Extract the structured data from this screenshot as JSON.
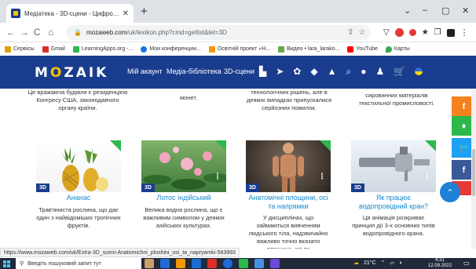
{
  "browser": {
    "tab_title": "Медіатека - 3D-сцени - Цифро…",
    "tab_close": "✕",
    "new_tab": "+",
    "window_controls": [
      "⌄",
      "–",
      "▢",
      "✕"
    ],
    "url_host": "mozaweb.com",
    "url_path": "/uk/lexikon.php?cmd=getlist&let=3D",
    "nav": {
      "back": "←",
      "forward": "→",
      "reload": "C",
      "home": "⌂"
    },
    "url_icons": [
      "⇪",
      "☆"
    ],
    "extensions": [
      "▽",
      "★",
      "❐"
    ]
  },
  "bookmarks": [
    {
      "label": "Сервісы",
      "color": "#e0a000"
    },
    {
      "label": "Gmail",
      "color": "#d93025"
    },
    {
      "label": "LearningApps.org -...",
      "color": "#2db84c"
    },
    {
      "label": "Мои конференции...",
      "color": "#1a73e8"
    },
    {
      "label": "Освітній проект «Н...",
      "color": "#f29900"
    },
    {
      "label": "Видео • lara_larako...",
      "color": "#6aa84f"
    },
    {
      "label": "YouTube",
      "color": "#ff0000"
    },
    {
      "label": "Карты",
      "color": "#34a853"
    }
  ],
  "site": {
    "logo_prefix": "M",
    "logo_o": "O",
    "logo_suffix": "ZAIK",
    "nav_links": {
      "account": "Мій акаунт",
      "media": "Медіа-бібліотека",
      "scenes": "3D-сцени"
    },
    "nav_icons": [
      "▙",
      "➤",
      "✿",
      "◆",
      "▲",
      "⌕",
      "●",
      "♟",
      "🛒"
    ]
  },
  "content": {
    "top_texts": [
      "Це вражаюча будівля є резиденцією Конгресу США, законодавчого органу країни.",
      "монет.",
      "технологічних рішень, але в деяких випадках припускалися серйозних помилок.",
      "сировинних матеріалів текстильної промисловості."
    ],
    "cards": [
      {
        "title": "Ананас",
        "desc": "Трав'яниста рослина, що дає один з найвідоміших тропічних фруктів.",
        "badge": "3D"
      },
      {
        "title": "Лотос індійський",
        "desc": "Велика водна рослина, що є важливим символом у деяких азійських культурах.",
        "badge": "3D"
      },
      {
        "title": "Анатомічні площини, осі та напрямки",
        "desc": "У дисциплінах, що займаються вивченням людського тіла, надзвичайно важливо точно вказати площини, осі та",
        "badge": "3D"
      },
      {
        "title": "Як працює водопровідний кран?",
        "desc": "Ця анімація розкриває принцип дії 3-х основних типів водопровідного крана.",
        "badge": "3D"
      }
    ],
    "dots": "⋮"
  },
  "social": [
    {
      "label": "f",
      "color": "#3b5998"
    },
    {
      "label": "♦",
      "color": "#2db84c"
    },
    {
      "label": "🐦",
      "color": "#1da1f2"
    },
    {
      "label": "f",
      "color": "#3b5998"
    },
    {
      "label": "✎",
      "color": "#e53935"
    }
  ],
  "social_top_labels": [
    "f",
    "♦",
    "🐦",
    "f"
  ],
  "up_button": "⌃",
  "status_url": "https://www.mozaweb.com/uk/Extra-3D_sceni-Anatomichni_ploshini_osi_ta_napryamki-583993",
  "taskbar": {
    "search_placeholder": "Введіть пошуковий запит тут",
    "search_icon": "⚲",
    "temperature": "21°C",
    "time": "4:31",
    "date": "12.09.2022",
    "app_colors": [
      "#c9a06a",
      "#1e6bd6",
      "#f29900",
      "#1e6bd6",
      "#d93025",
      "#1e6bd6",
      "#2db84c",
      "#4a90e2",
      "#6a4ad6"
    ]
  }
}
